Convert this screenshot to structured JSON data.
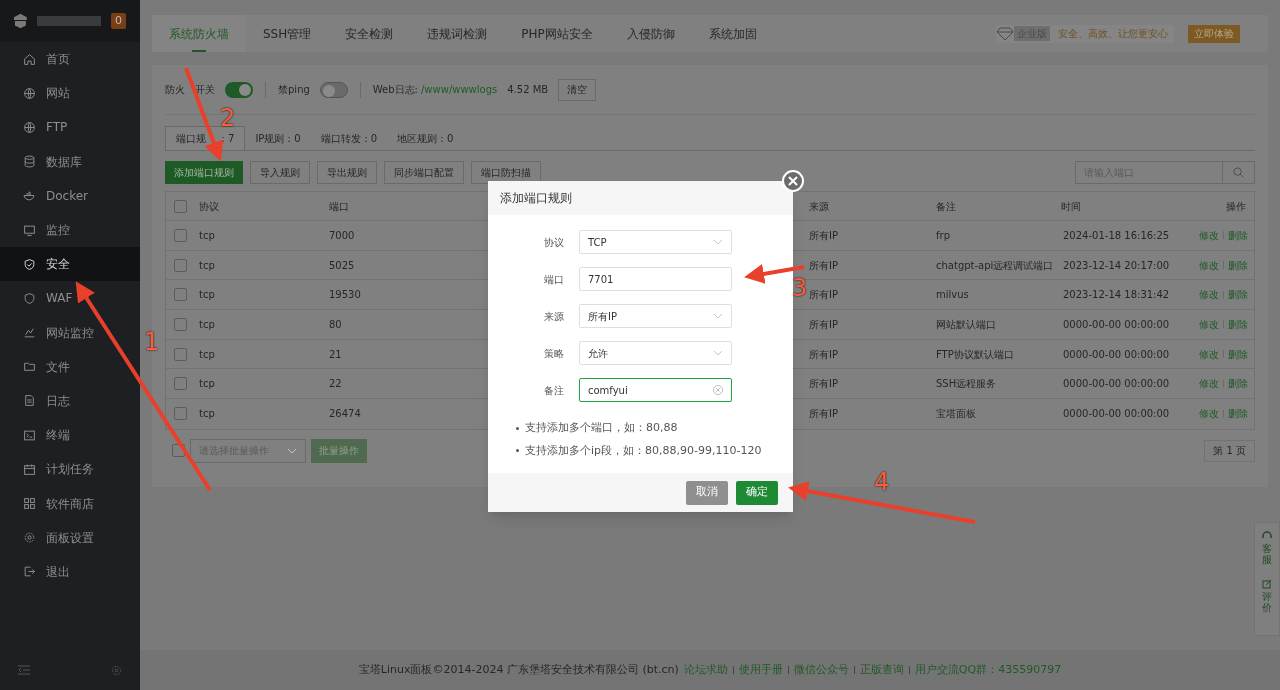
{
  "sidebar": {
    "badge": "0",
    "items": [
      {
        "label": "首页",
        "selected": false
      },
      {
        "label": "网站",
        "selected": false
      },
      {
        "label": "FTP",
        "selected": false
      },
      {
        "label": "数据库",
        "selected": false
      },
      {
        "label": "Docker",
        "selected": false
      },
      {
        "label": "监控",
        "selected": false
      },
      {
        "label": "安全",
        "selected": true
      },
      {
        "label": "WAF",
        "selected": false
      },
      {
        "label": "网站监控",
        "selected": false
      },
      {
        "label": "文件",
        "selected": false
      },
      {
        "label": "日志",
        "selected": false
      },
      {
        "label": "终端",
        "selected": false
      },
      {
        "label": "计划任务",
        "selected": false
      },
      {
        "label": "软件商店",
        "selected": false
      },
      {
        "label": "面板设置",
        "selected": false
      },
      {
        "label": "退出",
        "selected": false
      }
    ]
  },
  "top_tabs": [
    {
      "label": "系统防火墙",
      "selected": true
    },
    {
      "label": "SSH管理",
      "selected": false
    },
    {
      "label": "安全检测",
      "selected": false
    },
    {
      "label": "违规词检测",
      "selected": false
    },
    {
      "label": "PHP网站安全",
      "selected": false
    },
    {
      "label": "入侵防御",
      "selected": false
    },
    {
      "label": "系统加固",
      "selected": false
    }
  ],
  "promo": {
    "badge": "企业版",
    "slogan": "安全、高效、让您更安心",
    "button": "立即体验"
  },
  "settings": {
    "firewall": {
      "label_parts": [
        "防火",
        "开关"
      ],
      "on": true
    },
    "ping": {
      "label": "禁ping",
      "on": false
    },
    "log_label": "Web日志:",
    "log_path": "/www/wwwlogs",
    "log_size": "4.52 MB",
    "clear_button": "清空"
  },
  "sub_tabs": [
    {
      "label_parts": [
        "端口规",
        "：7"
      ],
      "selected": true
    },
    {
      "label_parts": [
        "IP规则：0"
      ],
      "selected": false
    },
    {
      "label_parts": [
        "端口转发：0"
      ],
      "selected": false
    },
    {
      "label_parts": [
        "地区规则：0"
      ],
      "selected": false
    }
  ],
  "toolbar": [
    {
      "label": "添加端口规则",
      "kind": "primary"
    },
    {
      "label": "导入规则",
      "kind": "default"
    },
    {
      "label": "导出规则",
      "kind": "default"
    },
    {
      "label": "同步端口配置",
      "kind": "default"
    },
    {
      "label": "端口防扫描",
      "kind": "default"
    }
  ],
  "search": {
    "placeholder": "请输入端口"
  },
  "table": {
    "all_checked": false,
    "columns": [
      "协议",
      "端口",
      "来源",
      "备注",
      "时间",
      "操作"
    ],
    "rows": [
      {
        "checked": false,
        "protocol": "tcp",
        "port": "7000",
        "source": "所有IP",
        "note": "frp",
        "time": "2024-01-18 16:16:25",
        "actions": [
          "修改",
          "删除"
        ]
      },
      {
        "checked": false,
        "protocol": "tcp",
        "port": "5025",
        "source": "所有IP",
        "note": "chatgpt-api远程调试端口",
        "time": "2023-12-14 20:17:00",
        "actions": [
          "修改",
          "删除"
        ]
      },
      {
        "checked": false,
        "protocol": "tcp",
        "port": "19530",
        "source": "所有IP",
        "note": "milvus",
        "time": "2023-12-14 18:31:42",
        "actions": [
          "修改",
          "删除"
        ]
      },
      {
        "checked": false,
        "protocol": "tcp",
        "port": "80",
        "source": "所有IP",
        "note": "网站默认端口",
        "time": "0000-00-00 00:00:00",
        "actions": [
          "修改",
          "删除"
        ]
      },
      {
        "checked": false,
        "protocol": "tcp",
        "port": "21",
        "source": "所有IP",
        "note": "FTP协议默认端口",
        "time": "0000-00-00 00:00:00",
        "actions": [
          "修改",
          "删除"
        ]
      },
      {
        "checked": false,
        "protocol": "tcp",
        "port": "22",
        "source": "所有IP",
        "note": "SSH远程服务",
        "time": "0000-00-00 00:00:00",
        "actions": [
          "修改",
          "删除"
        ]
      },
      {
        "checked": false,
        "protocol": "tcp",
        "port": "26474",
        "source": "所有IP",
        "note": "宝塔面板",
        "time": "0000-00-00 00:00:00",
        "actions": [
          "修改",
          "删除"
        ]
      }
    ]
  },
  "batch": {
    "checked": false,
    "placeholder": "请选择批量操作",
    "button": "批量操作",
    "pager": "第 1 页"
  },
  "dialog": {
    "title": "添加端口规则",
    "fields": [
      {
        "label": "协议",
        "kind": "select",
        "value": "TCP"
      },
      {
        "label": "端口",
        "kind": "input",
        "value": "7701"
      },
      {
        "label": "来源",
        "kind": "select",
        "value": "所有IP"
      },
      {
        "label": "策略",
        "kind": "select",
        "value": "允许"
      },
      {
        "label": "备注",
        "kind": "clearable",
        "value": "comfyui"
      }
    ],
    "notes": [
      "支持添加多个端口，如：80,88",
      "支持添加多个ip段，如：80,88,90-99,110-120"
    ],
    "buttons": [
      {
        "label": "取消",
        "kind": "secondary"
      },
      {
        "label": "确定",
        "kind": "primary"
      }
    ]
  },
  "side_widget": [
    "客服",
    "评价"
  ],
  "footer": {
    "text": "宝塔Linux面板©2014-2024 广东堡塔安全技术有限公司 (bt.cn)",
    "links": [
      "论坛求助",
      "使用手册",
      "微信公众号",
      "正版查询",
      "用户交流QQ群：435590797"
    ]
  },
  "annotations": [
    "1",
    "2",
    "3",
    "4"
  ]
}
